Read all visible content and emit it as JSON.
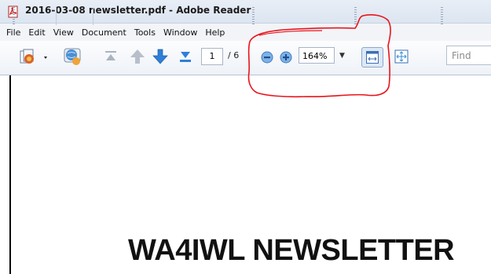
{
  "window": {
    "title": "2016-03-08 newsletter.pdf - Adobe Reader"
  },
  "menu": [
    "File",
    "Edit",
    "View",
    "Document",
    "Tools",
    "Window",
    "Help"
  ],
  "toolbar": {
    "page_number": "1",
    "page_total": "/ 6",
    "zoom": "164%",
    "find_placeholder": "Find"
  },
  "document": {
    "heading": "WA4IWL NEWSLETTER"
  },
  "colors": {
    "annotation": "#e8141b",
    "arrow_blue": "#2f7fd8"
  }
}
